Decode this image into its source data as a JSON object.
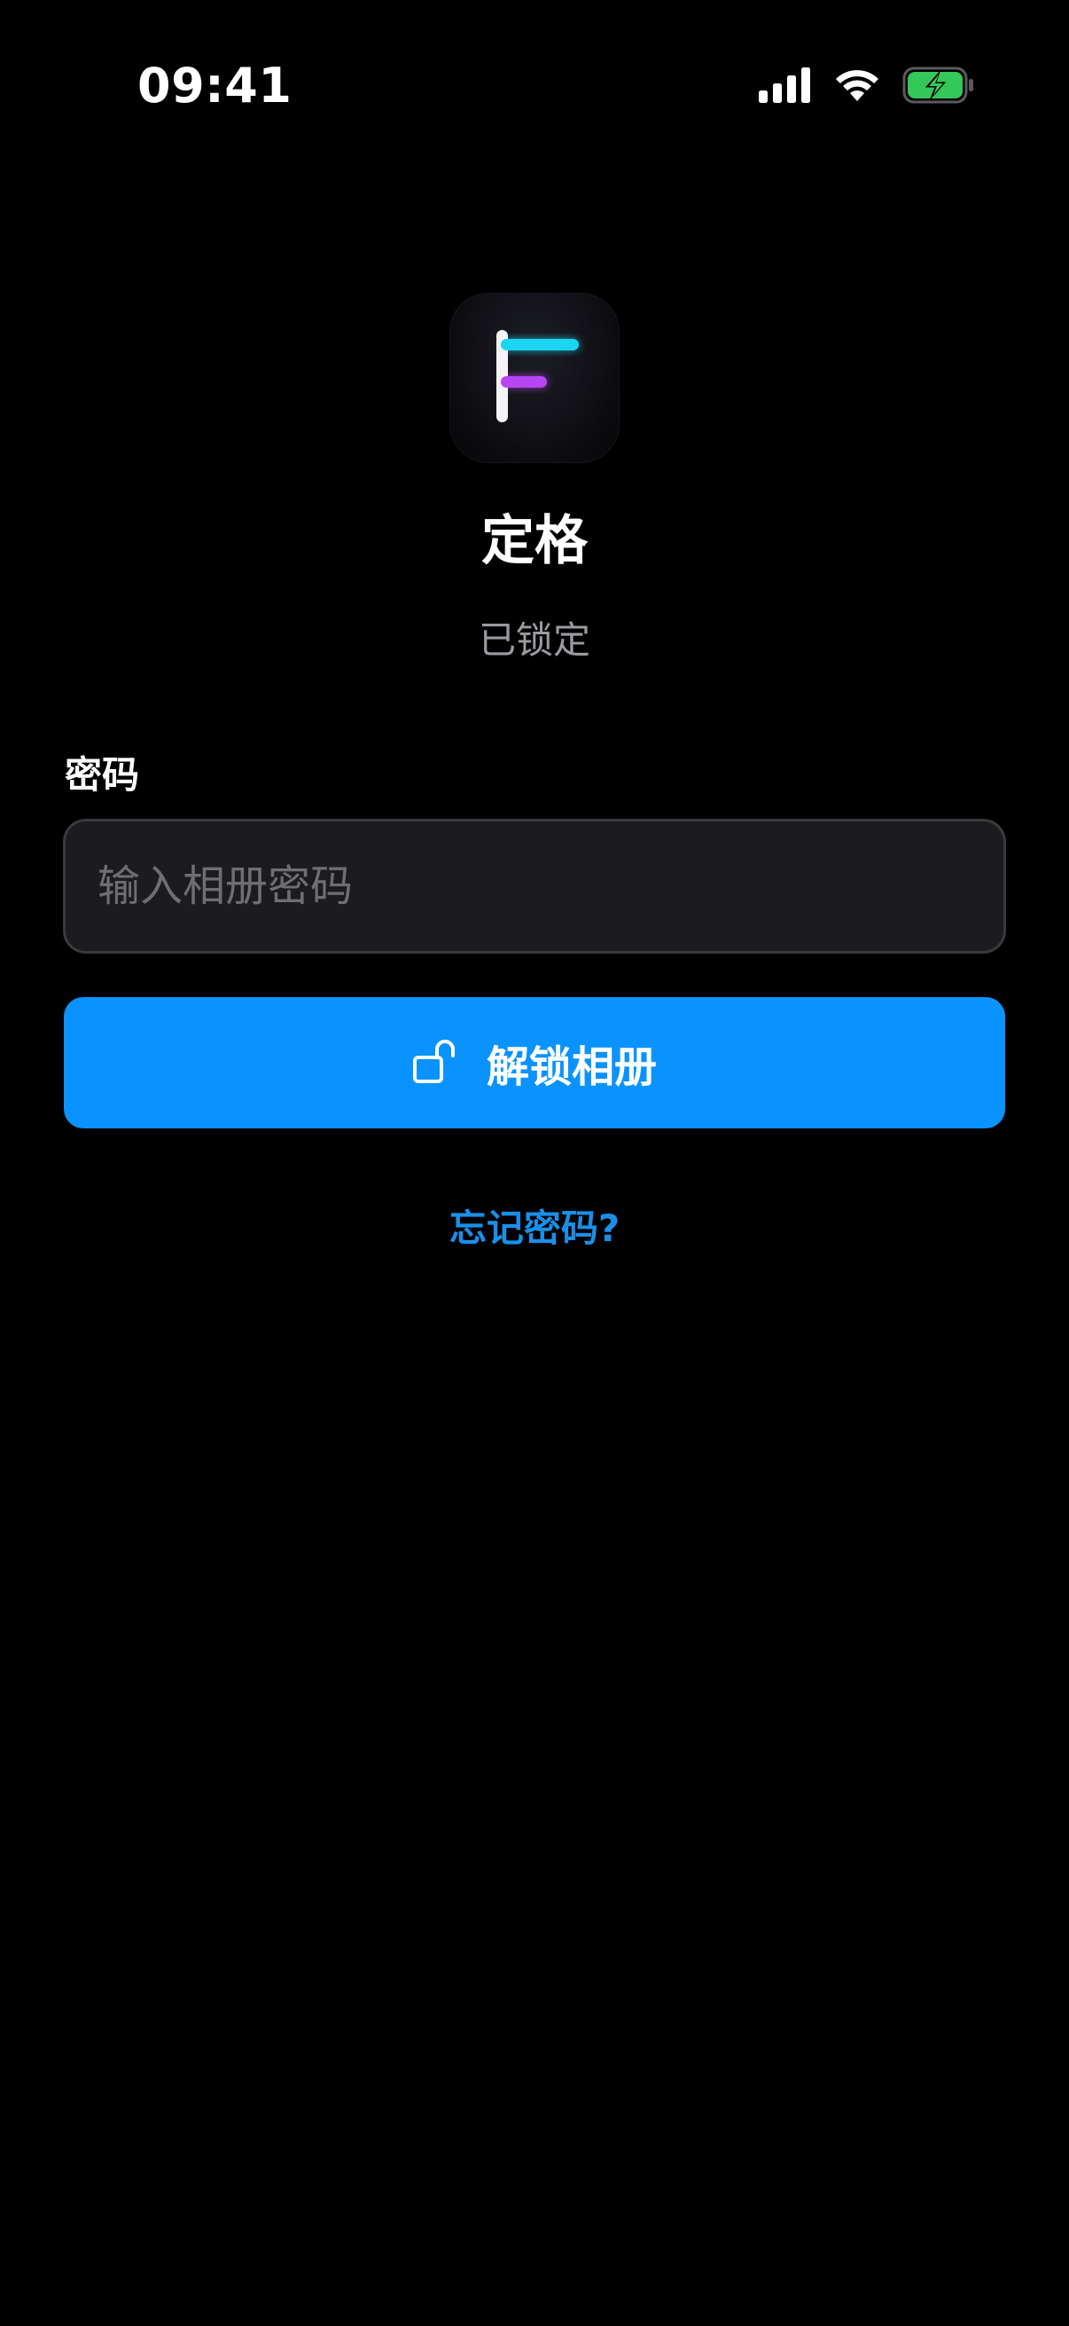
{
  "status_bar": {
    "time": "09:41",
    "icons": [
      "cellular-signal-icon",
      "wifi-icon",
      "battery-charging-icon"
    ]
  },
  "app": {
    "icon": "app-logo-icon",
    "name": "定格",
    "status": "已锁定"
  },
  "form": {
    "password_label": "密码",
    "password_placeholder": "输入相册密码",
    "password_value": "",
    "unlock_label": "解锁相册",
    "unlock_icon": "unlock-icon",
    "forgot_label": "忘记密码?"
  },
  "colors": {
    "background": "#000000",
    "accent": "#0a93ff",
    "link": "#1a8fe8",
    "input_bg": "#1c1c1e",
    "battery": "#34c759",
    "logo_cyan": "#1ad6f0",
    "logo_purple": "#b845f2"
  }
}
